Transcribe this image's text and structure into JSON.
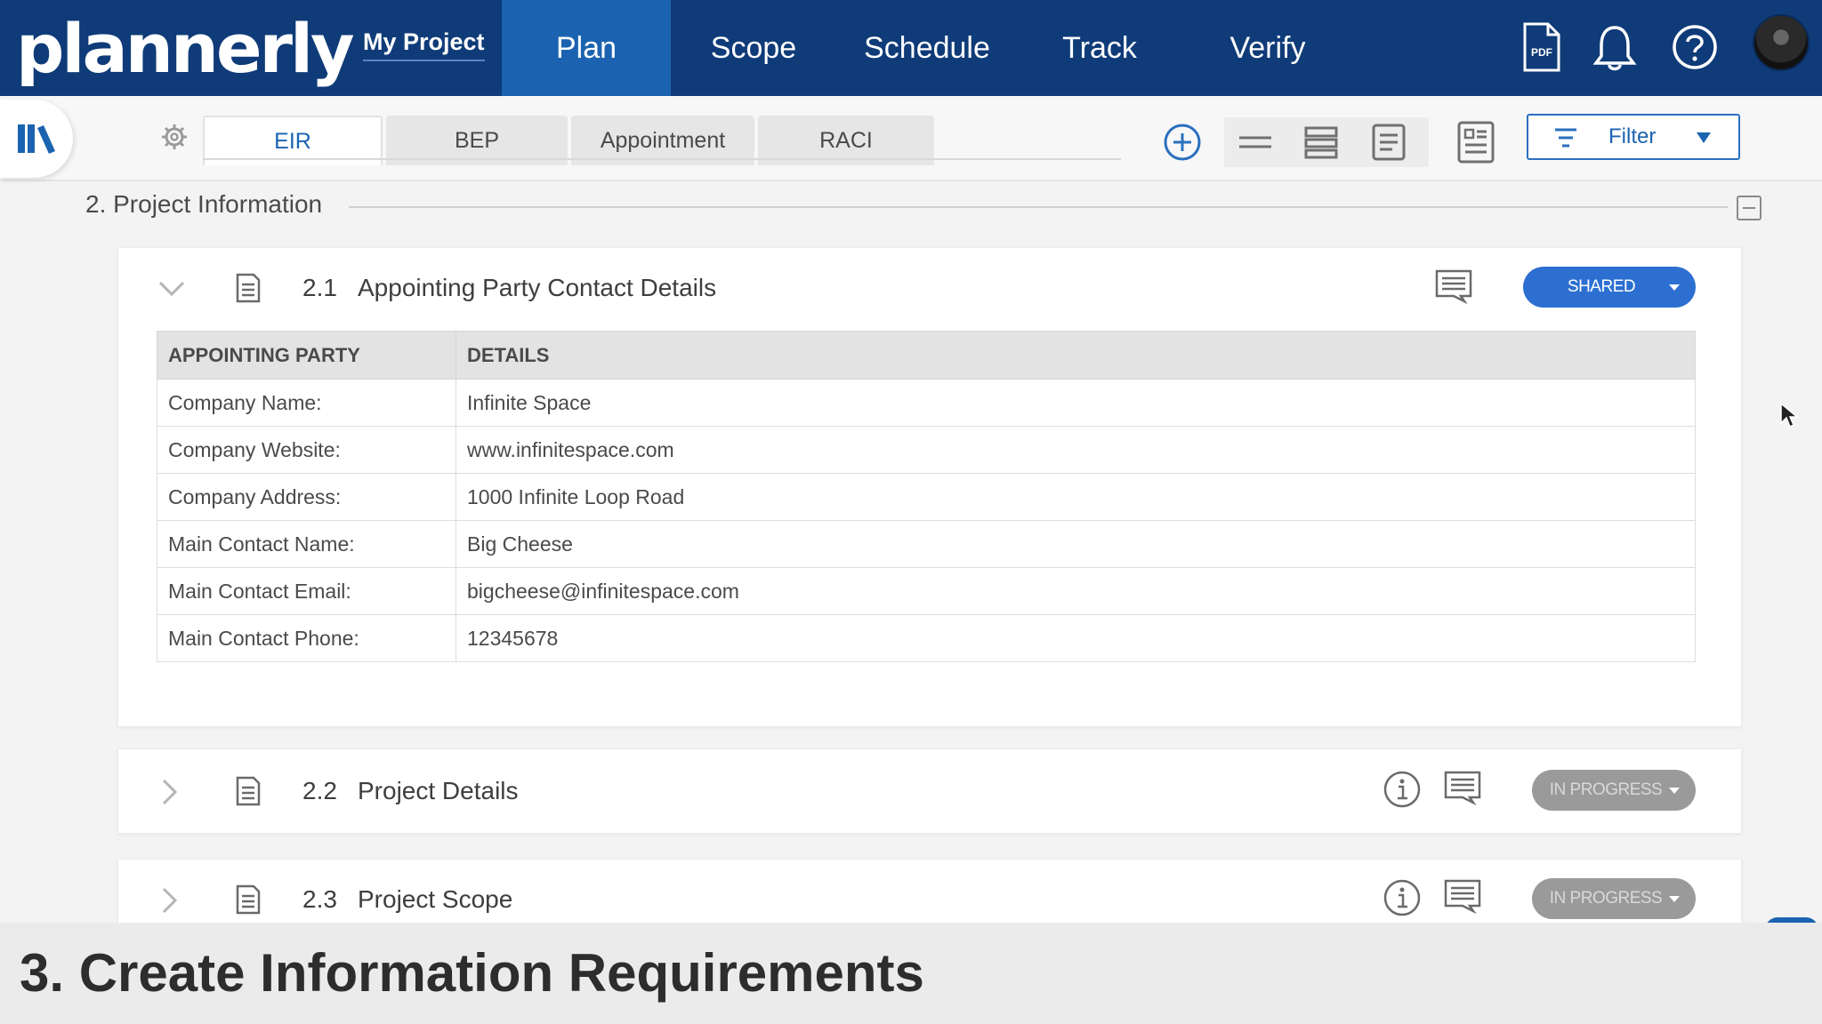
{
  "app": {
    "logo": "plannerly",
    "project_link": "My Project",
    "nav": [
      "Plan",
      "Scope",
      "Schedule",
      "Track",
      "Verify"
    ],
    "active_nav": "Plan",
    "pdf_icon_text": "PDF"
  },
  "subbar": {
    "tabs": [
      "EIR",
      "BEP",
      "Appointment",
      "RACI"
    ],
    "active_tab": "EIR",
    "filter_label": "Filter"
  },
  "section": {
    "title": "2. Project Information"
  },
  "cards": [
    {
      "number": "2.1",
      "title": "Appointing Party Contact Details",
      "status": "SHARED",
      "expanded": true,
      "table": {
        "headers": [
          "APPOINTING PARTY",
          "DETAILS"
        ],
        "rows": [
          [
            "Company Name:",
            "Infinite Space"
          ],
          [
            "Company Website:",
            "www.infinitespace.com"
          ],
          [
            "Company Address:",
            "1000 Infinite Loop Road"
          ],
          [
            "Main Contact Name:",
            "Big Cheese"
          ],
          [
            "Main Contact Email:",
            "bigcheese@infinitespace.com"
          ],
          [
            "Main Contact Phone:",
            "12345678"
          ]
        ]
      }
    },
    {
      "number": "2.2",
      "title": "Project Details",
      "status": "IN PROGRESS",
      "expanded": false
    },
    {
      "number": "2.3",
      "title": "Project Scope",
      "status": "IN PROGRESS",
      "expanded": false
    }
  ],
  "caption": "3. Create Information Requirements",
  "colors": {
    "nav_bg": "#0f3b78",
    "nav_active": "#1b63b0",
    "shared": "#2c6fd1",
    "in_progress": "#9a9a9a"
  }
}
